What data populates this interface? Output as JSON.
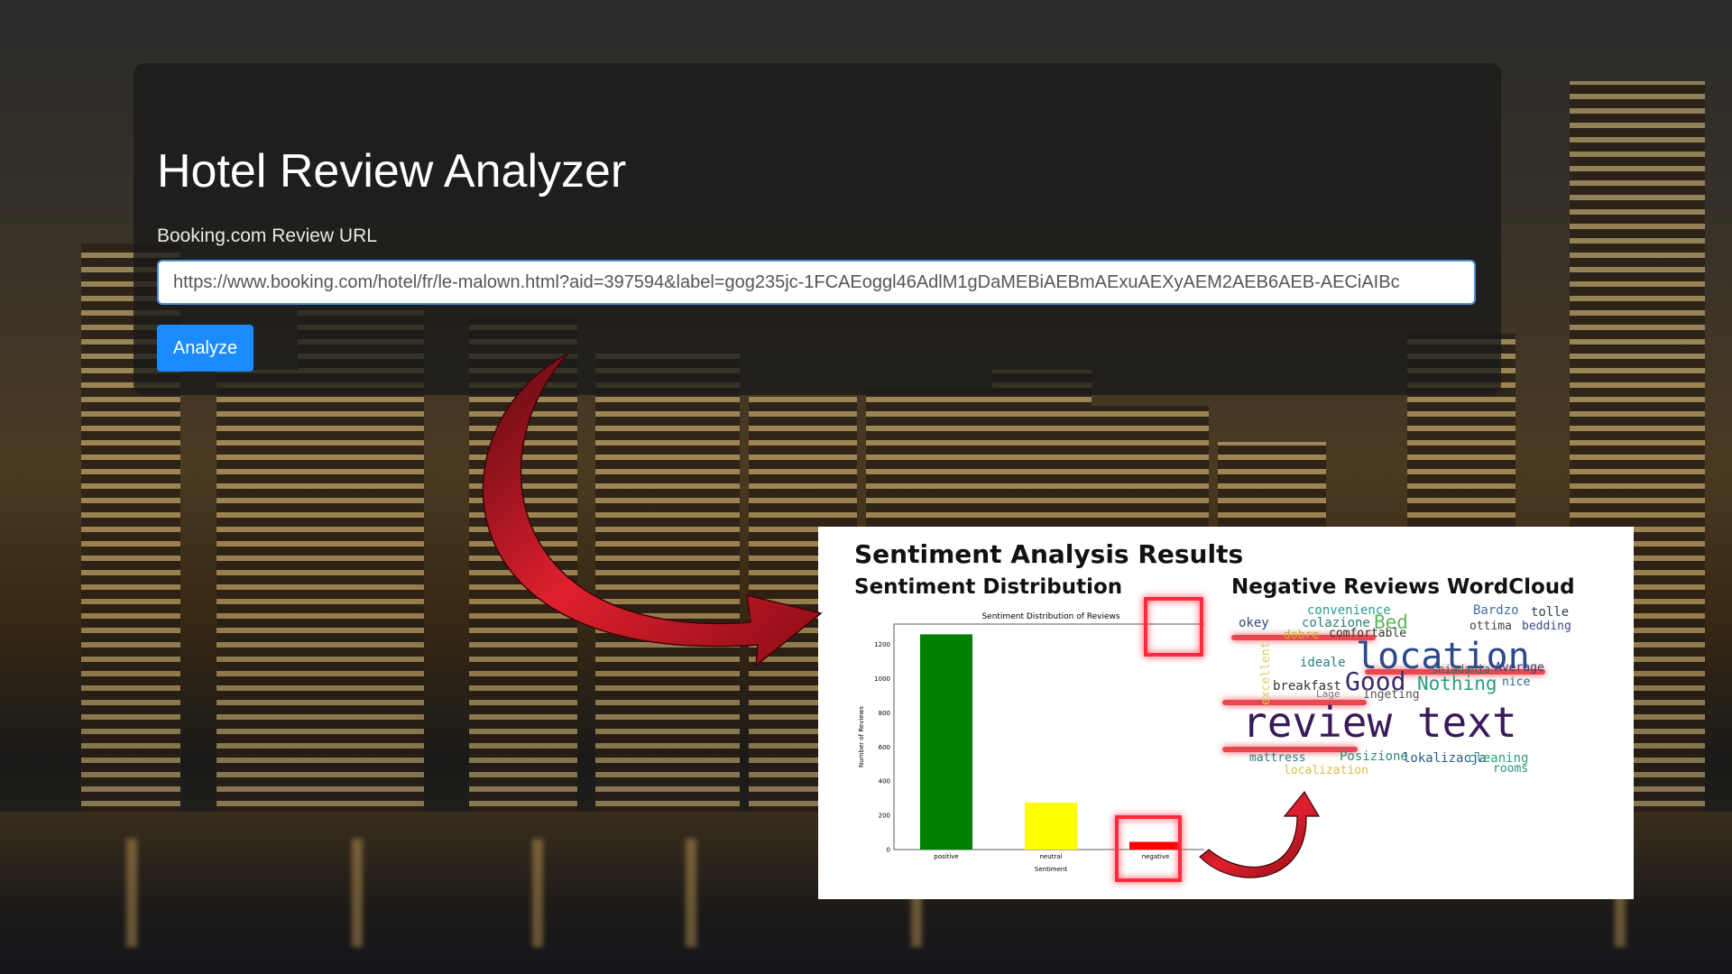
{
  "app": {
    "title": "Hotel Review Analyzer",
    "url_label": "Booking.com Review URL",
    "url_value": "https://www.booking.com/hotel/fr/le-malown.html?aid=397594&label=gog235jc-1FCAEoggl46AdlM1gDaMEBiAEBmAExuAEXyAEM2AEB6AEB-AECiAIBc",
    "analyze_label": "Analyze"
  },
  "results": {
    "title": "Sentiment Analysis Results",
    "distribution_title": "Sentiment Distribution",
    "wordcloud_title": "Negative Reviews WordCloud"
  },
  "chart_data": {
    "type": "bar",
    "title": "Sentiment Distribution of Reviews",
    "xlabel": "Sentiment",
    "ylabel": "Number of Reviews",
    "categories": [
      "positive",
      "neutral",
      "negative"
    ],
    "values": [
      1260,
      275,
      45
    ],
    "colors": [
      "#008000",
      "#ffff00",
      "#ff0000"
    ],
    "ylim": [
      0,
      1320
    ],
    "yticks": [
      0,
      200,
      400,
      600,
      800,
      1000,
      1200
    ],
    "grid": false
  },
  "wordcloud": [
    {
      "text": "convenience",
      "color": "#2a9d8f"
    },
    {
      "text": "Bardzo",
      "color": "#3b6ea5"
    },
    {
      "text": "tolle",
      "color": "#2c3e50"
    },
    {
      "text": "okey",
      "color": "#2c4a7a"
    },
    {
      "text": "colazione",
      "color": "#2a7d7a"
    },
    {
      "text": "Bed",
      "color": "#5cb85c"
    },
    {
      "text": "ottima",
      "color": "#444"
    },
    {
      "text": "bedding",
      "color": "#3b4a8a"
    },
    {
      "text": "dobre",
      "color": "#c9b52b"
    },
    {
      "text": "comfortable",
      "color": "#333"
    },
    {
      "text": "excellent",
      "color": "#d6d060"
    },
    {
      "text": "ideale",
      "color": "#2a7d7a"
    },
    {
      "text": "location",
      "color": "#2c4a8a"
    },
    {
      "text": "sniadania",
      "color": "#2c6a6a"
    },
    {
      "text": "Average",
      "color": "#2c3e7a"
    },
    {
      "text": "breakfast",
      "color": "#333"
    },
    {
      "text": "Good",
      "color": "#3a2a6a"
    },
    {
      "text": "Nothing",
      "color": "#2a9d7f"
    },
    {
      "text": "nice",
      "color": "#2a6d8a"
    },
    {
      "text": "Ingeting",
      "color": "#555"
    },
    {
      "text": "Lage",
      "color": "#777"
    },
    {
      "text": "review text",
      "color": "#3a1a5a"
    },
    {
      "text": "mattress",
      "color": "#2a7d7a"
    },
    {
      "text": "Posizione",
      "color": "#2a8d7a"
    },
    {
      "text": "lokalizacja",
      "color": "#2a5a8a"
    },
    {
      "text": "cleaning",
      "color": "#2aa37a"
    },
    {
      "text": "rooms",
      "color": "#2a8d7a"
    },
    {
      "text": "localization",
      "color": "#d6c040"
    }
  ]
}
